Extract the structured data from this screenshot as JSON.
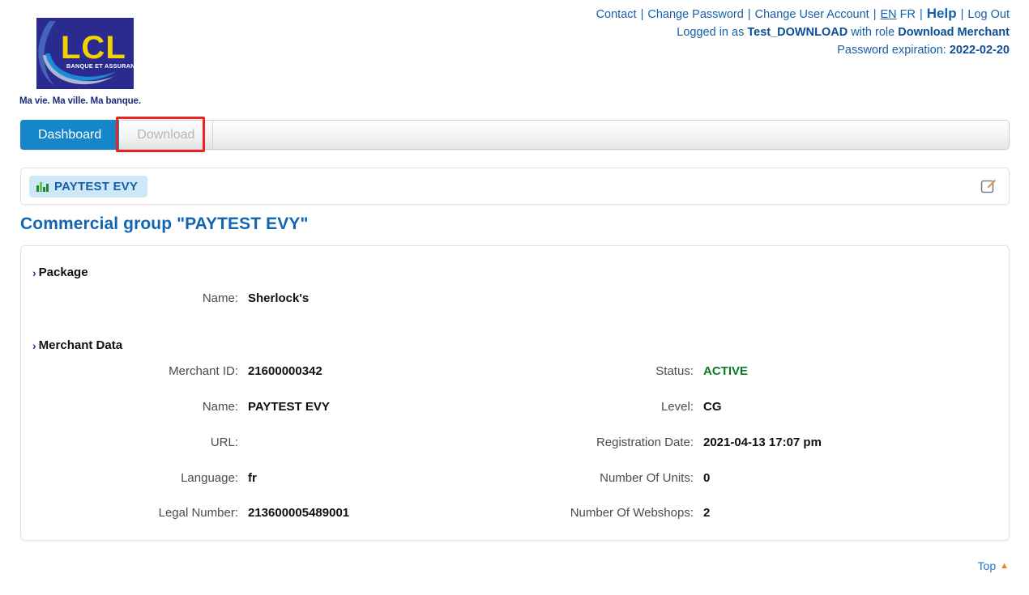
{
  "brand": {
    "logo_text": "LCL",
    "logo_subtext": "BANQUE ET ASSURANCE",
    "slogan": "Ma vie. Ma ville. Ma banque."
  },
  "header": {
    "links": [
      {
        "label": "Contact",
        "name": "contact-link"
      },
      {
        "label": "Change Password",
        "name": "change-password-link"
      },
      {
        "label": "Change User Account",
        "name": "change-user-account-link"
      }
    ],
    "lang_active": "EN",
    "lang_inactive": "FR",
    "help_label": "Help",
    "logout_label": "Log Out",
    "separator": "|",
    "logged_in_prefix": "Logged in as",
    "logged_in_user": "Test_DOWNLOAD",
    "logged_in_mid": "with role",
    "logged_in_role": "Download Merchant",
    "password_expiration_label": "Password expiration:",
    "password_expiration_value": "2022-02-20"
  },
  "tabs": [
    {
      "label": "Dashboard",
      "name": "tab-dashboard",
      "active": true
    },
    {
      "label": "Download",
      "name": "tab-download",
      "active": false
    }
  ],
  "badge": {
    "icon": "bar-chart-icon",
    "label": "PAYTEST EVY",
    "edit_icon": "edit-square-icon"
  },
  "page": {
    "title": "Commercial group \"PAYTEST EVY\""
  },
  "sections": {
    "package": {
      "heading": "Package",
      "fields": [
        {
          "label": "Name:",
          "value": "Sherlock's"
        }
      ]
    },
    "merchant_data": {
      "heading": "Merchant Data",
      "left_fields": [
        {
          "label": "Merchant ID:",
          "value": "21600000342"
        },
        {
          "label": "Name:",
          "value": "PAYTEST EVY"
        },
        {
          "label": "URL:",
          "value": ""
        },
        {
          "label": "Language:",
          "value": "fr"
        },
        {
          "label": "Legal Number:",
          "value": "213600005489001"
        }
      ],
      "right_fields": [
        {
          "label": "Status:",
          "value": "ACTIVE",
          "color": "green"
        },
        {
          "label": "Level:",
          "value": "CG"
        },
        {
          "label": "Registration Date:",
          "value": "2021-04-13 17:07 pm"
        },
        {
          "label": "Number Of Units:",
          "value": "0"
        },
        {
          "label": "Number Of Webshops:",
          "value": "2"
        }
      ]
    }
  },
  "footer": {
    "top_label": "Top",
    "top_arrow": "▲"
  },
  "colors": {
    "brand_blue": "#2b2b8f",
    "logo_yellow": "#f2d200",
    "link_blue": "#1560a8",
    "tab_active_blue": "#1686cb",
    "title_blue": "#1166b3",
    "status_green": "#0a7a25",
    "highlight_red": "#ee2222",
    "badge_bg": "#cfe8f7",
    "edit_icon_orange": "#d99a5c"
  }
}
